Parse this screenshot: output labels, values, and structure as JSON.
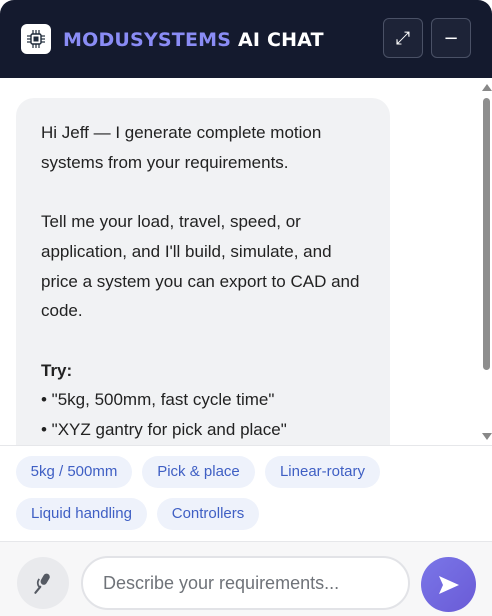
{
  "header": {
    "brand": "MODUSYSTEMS",
    "title_rest": "AI CHAT",
    "logo_icon": "circuit-chip-icon",
    "expand_icon": "⤢",
    "minimize_icon": "−"
  },
  "message": {
    "line1": "Hi Jeff — I generate complete motion systems from your requirements.",
    "line2": "Tell me your load, travel, speed, or application, and I'll build, simulate, and price a system you can export to CAD and code.",
    "try_label": "Try:",
    "examples": [
      "• \"5kg, 500mm, fast cycle time\"",
      "• \"XYZ gantry for pick and place\""
    ]
  },
  "chips": [
    "5kg / 500mm",
    "Pick & place",
    "Linear-rotary",
    "Liquid handling",
    "Controllers"
  ],
  "composer": {
    "placeholder": "Describe your requirements...",
    "mic_icon": "microphone-icon",
    "send_icon": "send-icon"
  },
  "colors": {
    "header_bg": "#141a2e",
    "brand": "#8a8cf5",
    "chip_text": "#3f5fc4",
    "chip_bg": "#eef2fb",
    "send": "#6a5bd6"
  }
}
